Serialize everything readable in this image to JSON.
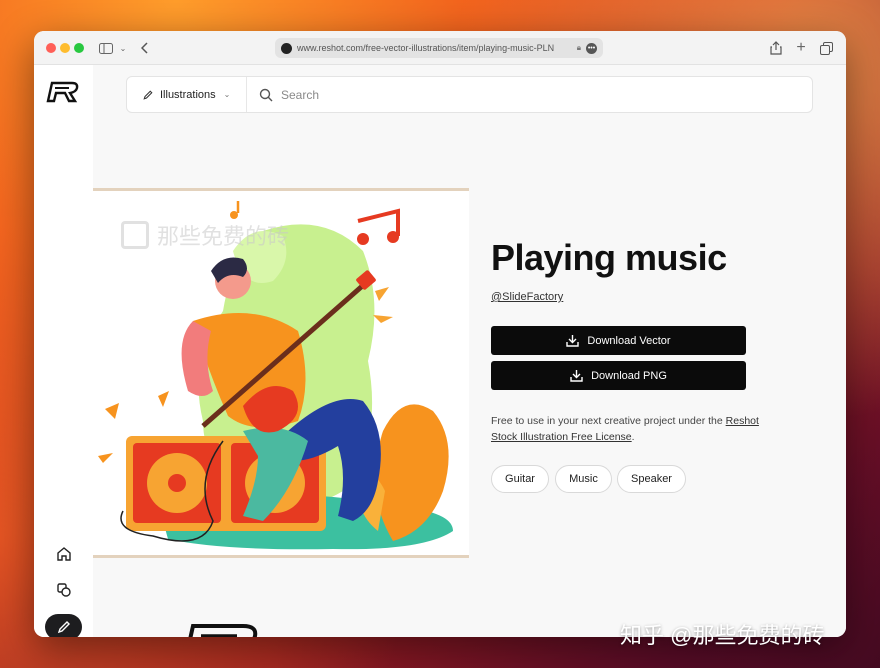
{
  "browser": {
    "url": "www.reshot.com/free-vector-illustrations/item/playing-music-PLN"
  },
  "search": {
    "category_label": "Illustrations",
    "placeholder": "Search"
  },
  "item": {
    "title": "Playing music",
    "author": "@SlideFactory",
    "download_vector_label": "Download Vector",
    "download_png_label": "Download PNG",
    "license_text": "Free to use in your next creative project under the",
    "license_link": "Reshot Stock Illustration Free License",
    "license_end": ".",
    "tags": [
      "Guitar",
      "Music",
      "Speaker"
    ]
  },
  "illustration": {
    "watermark_text": "那些免费的砖"
  },
  "overlay": {
    "watermark_text": "知乎 @那些免费的砖"
  },
  "colors": {
    "accent_black": "#0b0b0b",
    "illustration_orange": "#f7931e",
    "illustration_green": "#c8f08f",
    "illustration_red": "#e63a21"
  }
}
